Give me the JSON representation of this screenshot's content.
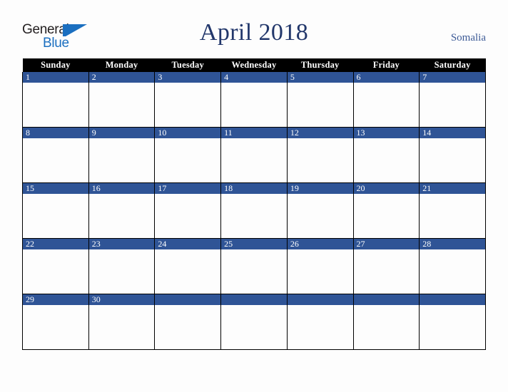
{
  "brand": {
    "word_one": "General",
    "word_two": "Blue",
    "mark_icon": "triangle-logo-icon",
    "color_black": "#231f20",
    "color_blue": "#1b6fc0"
  },
  "header": {
    "title": "April 2018",
    "country": "Somalia",
    "title_color": "#22376b",
    "country_color": "#3c5a96"
  },
  "calendar": {
    "weekday_headers": [
      "Sunday",
      "Monday",
      "Tuesday",
      "Wednesday",
      "Thursday",
      "Friday",
      "Saturday"
    ],
    "header_bg": "#000000",
    "header_text": "#ffffff",
    "daynum_bg": "#2f5496",
    "daynum_text": "#ffffff",
    "cell_bg": "#fdfdfd",
    "border_color": "#000000",
    "weeks": [
      [
        "1",
        "2",
        "3",
        "4",
        "5",
        "6",
        "7"
      ],
      [
        "8",
        "9",
        "10",
        "11",
        "12",
        "13",
        "14"
      ],
      [
        "15",
        "16",
        "17",
        "18",
        "19",
        "20",
        "21"
      ],
      [
        "22",
        "23",
        "24",
        "25",
        "26",
        "27",
        "28"
      ],
      [
        "29",
        "30",
        "",
        "",
        "",
        "",
        ""
      ]
    ]
  },
  "chart_data": {
    "type": "table",
    "title": "April 2018",
    "subtitle": "Somalia",
    "categories": [
      "Sunday",
      "Monday",
      "Tuesday",
      "Wednesday",
      "Thursday",
      "Friday",
      "Saturday"
    ],
    "rows": [
      [
        "1",
        "2",
        "3",
        "4",
        "5",
        "6",
        "7"
      ],
      [
        "8",
        "9",
        "10",
        "11",
        "12",
        "13",
        "14"
      ],
      [
        "15",
        "16",
        "17",
        "18",
        "19",
        "20",
        "21"
      ],
      [
        "22",
        "23",
        "24",
        "25",
        "26",
        "27",
        "28"
      ],
      [
        "29",
        "30",
        "",
        "",
        "",
        "",
        ""
      ]
    ]
  }
}
